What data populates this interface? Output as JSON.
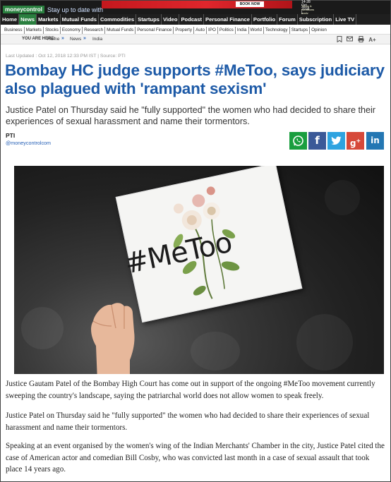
{
  "header": {
    "logo": "moneycontrol",
    "tagline": "Stay up to date with",
    "ad": {
      "button": "BOOK NOW",
      "line1": "14-28 Oct 2018 | Home now till 30 Jun 2019",
      "line2": "Terms & conditions apply"
    }
  },
  "main_nav": [
    "Home",
    "News",
    "Markets",
    "Mutual Funds",
    "Commodities",
    "Startups",
    "Video",
    "Podcast",
    "Personal Finance",
    "Portfolio",
    "Forum",
    "Subscription",
    "Live TV"
  ],
  "main_nav_active": "News",
  "sub_nav": [
    "Business",
    "Markets",
    "Stocks",
    "Economy",
    "Research",
    "Mutual Funds",
    "Personal Finance",
    "Property",
    "Auto",
    "IPO",
    "Politics",
    "India",
    "World",
    "Technology",
    "Startups",
    "Opinion"
  ],
  "breadcrumb": {
    "label": "YOU ARE HERE:",
    "items": [
      "Home",
      "News",
      "India"
    ]
  },
  "tools": {
    "bookmark": "bookmark-icon",
    "email": "mail-icon",
    "print": "print-icon",
    "font": "A+"
  },
  "article": {
    "updated": "Last Updated : Oct 12, 2018 12:33 PM IST | Source: PTI",
    "headline": "Bombay HC judge supports #MeToo, says judiciary also plagued with 'rampant sexism'",
    "summary": "Justice Patel on Thursday said he \"fully supported\" the women who had decided to share their experiences of sexual harassment and name their tormentors.",
    "author": "PTI",
    "handle": "@moneycontrolcom",
    "image_text": "#MeToo",
    "paragraphs": [
      "Justice Gautam Patel of the Bombay High Court has come out in support of the ongoing #MeToo movement currently sweeping the country's landscape, saying the patriarchal world does not allow women to speak freely.",
      "Justice Patel on Thursday said he \"fully supported\" the women who had decided to share their experiences of sexual harassment and name their tormentors.",
      "Speaking at an event organised by the women's wing of the Indian Merchants' Chamber in the city, Justice Patel cited the case of American actor and comedian Bill Cosby, who was convicted last month in a case of sexual assault that took place 14 years ago."
    ]
  },
  "share": [
    {
      "name": "whatsapp",
      "glyph": "✆",
      "color": "#1a9e3f"
    },
    {
      "name": "facebook",
      "glyph": "f",
      "color": "#3b5998"
    },
    {
      "name": "twitter",
      "glyph": "t",
      "color": "#2ea3e0"
    },
    {
      "name": "google-plus",
      "glyph": "g+",
      "color": "#d6493a"
    },
    {
      "name": "linkedin",
      "glyph": "in",
      "color": "#2477b3"
    }
  ],
  "colors": {
    "brand_green": "#2a7f3f",
    "headline_blue": "#1d5aa7",
    "nav_dark": "#1f1f1f"
  }
}
